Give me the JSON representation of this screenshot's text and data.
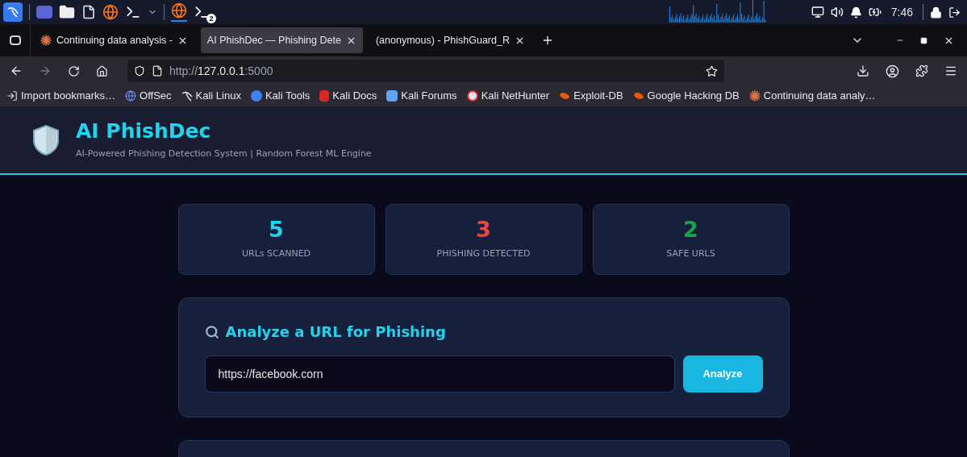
{
  "taskbar": {
    "terminal_badge": "2",
    "clock": "7:46"
  },
  "tabs": [
    {
      "label": "Continuing data analysis -",
      "selected": false,
      "kind": "spark"
    },
    {
      "label": "AI PhishDec — Phishing Dete",
      "selected": true,
      "kind": "plain"
    },
    {
      "label": "(anonymous) - PhishGuard_R",
      "selected": false,
      "kind": "plain"
    }
  ],
  "address": {
    "scheme": "http://",
    "host": "127.0.0.1",
    "port": ":5000"
  },
  "bookmarks": [
    {
      "label": "Import bookmarks…",
      "kind": "import"
    },
    {
      "label": "OffSec",
      "kind": "offsec"
    },
    {
      "label": "Kali Linux",
      "kind": "kali"
    },
    {
      "label": "Kali Tools",
      "kind": "tools"
    },
    {
      "label": "Kali Docs",
      "kind": "docs"
    },
    {
      "label": "Kali Forums",
      "kind": "forums"
    },
    {
      "label": "Kali NetHunter",
      "kind": "nethunter"
    },
    {
      "label": "Exploit-DB",
      "kind": "exploit"
    },
    {
      "label": "Google Hacking DB",
      "kind": "exploit"
    },
    {
      "label": "Continuing data analy…",
      "kind": "spark"
    }
  ],
  "header": {
    "title": "AI PhishDec",
    "subtitle": "AI-Powered Phishing Detection System | Random Forest ML Engine"
  },
  "stats": [
    {
      "value": "5",
      "label": "URLs SCANNED",
      "color": "#22d3ee"
    },
    {
      "value": "3",
      "label": "PHISHING DETECTED",
      "color": "#ef4444"
    },
    {
      "value": "2",
      "label": "SAFE URLS",
      "color": "#16a34a"
    }
  ],
  "analyze": {
    "heading": "Analyze a URL for Phishing",
    "url": "https://facebook.corn",
    "button": "Analyze"
  }
}
